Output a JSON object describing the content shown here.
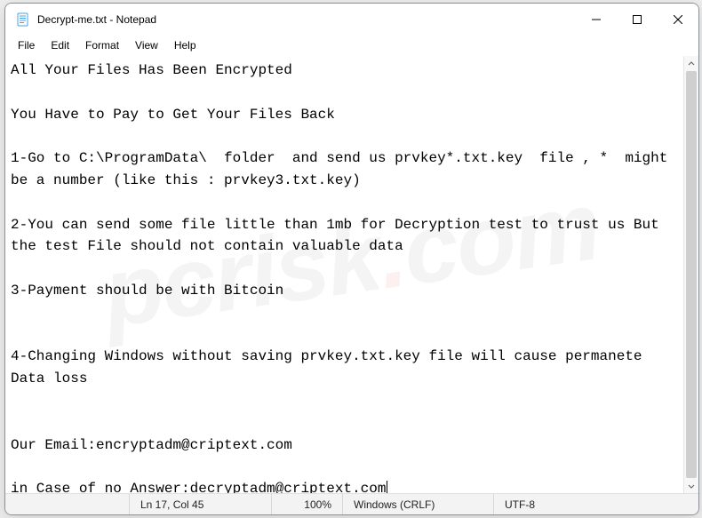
{
  "window": {
    "title": "Decrypt-me.txt - Notepad"
  },
  "menu": {
    "file": "File",
    "edit": "Edit",
    "format": "Format",
    "view": "View",
    "help": "Help"
  },
  "document": {
    "line1": "All Your Files Has Been Encrypted",
    "line2": "",
    "line3": "You Have to Pay to Get Your Files Back",
    "line4": "",
    "line5": "1-Go to C:\\ProgramData\\  folder  and send us prvkey*.txt.key  file , *  might be a number (like this : prvkey3.txt.key)",
    "line6": "",
    "line7": "2-You can send some file little than 1mb for Decryption test to trust us But the test File should not contain valuable data",
    "line8": "",
    "line9": "3-Payment should be with Bitcoin",
    "line10": "",
    "line11": "",
    "line12": "4-Changing Windows without saving prvkey.txt.key file will cause permanete Data loss",
    "line13": "",
    "line14": "",
    "line15": "Our Email:encryptadm@criptext.com",
    "line16": "",
    "line17": "in Case of no Answer:decryptadm@criptext.com"
  },
  "status": {
    "position": "Ln 17, Col 45",
    "zoom": "100%",
    "eol": "Windows (CRLF)",
    "encoding": "UTF-8"
  },
  "watermark": {
    "text_left": "pcrisk",
    "dot": ".",
    "text_right": "com"
  }
}
